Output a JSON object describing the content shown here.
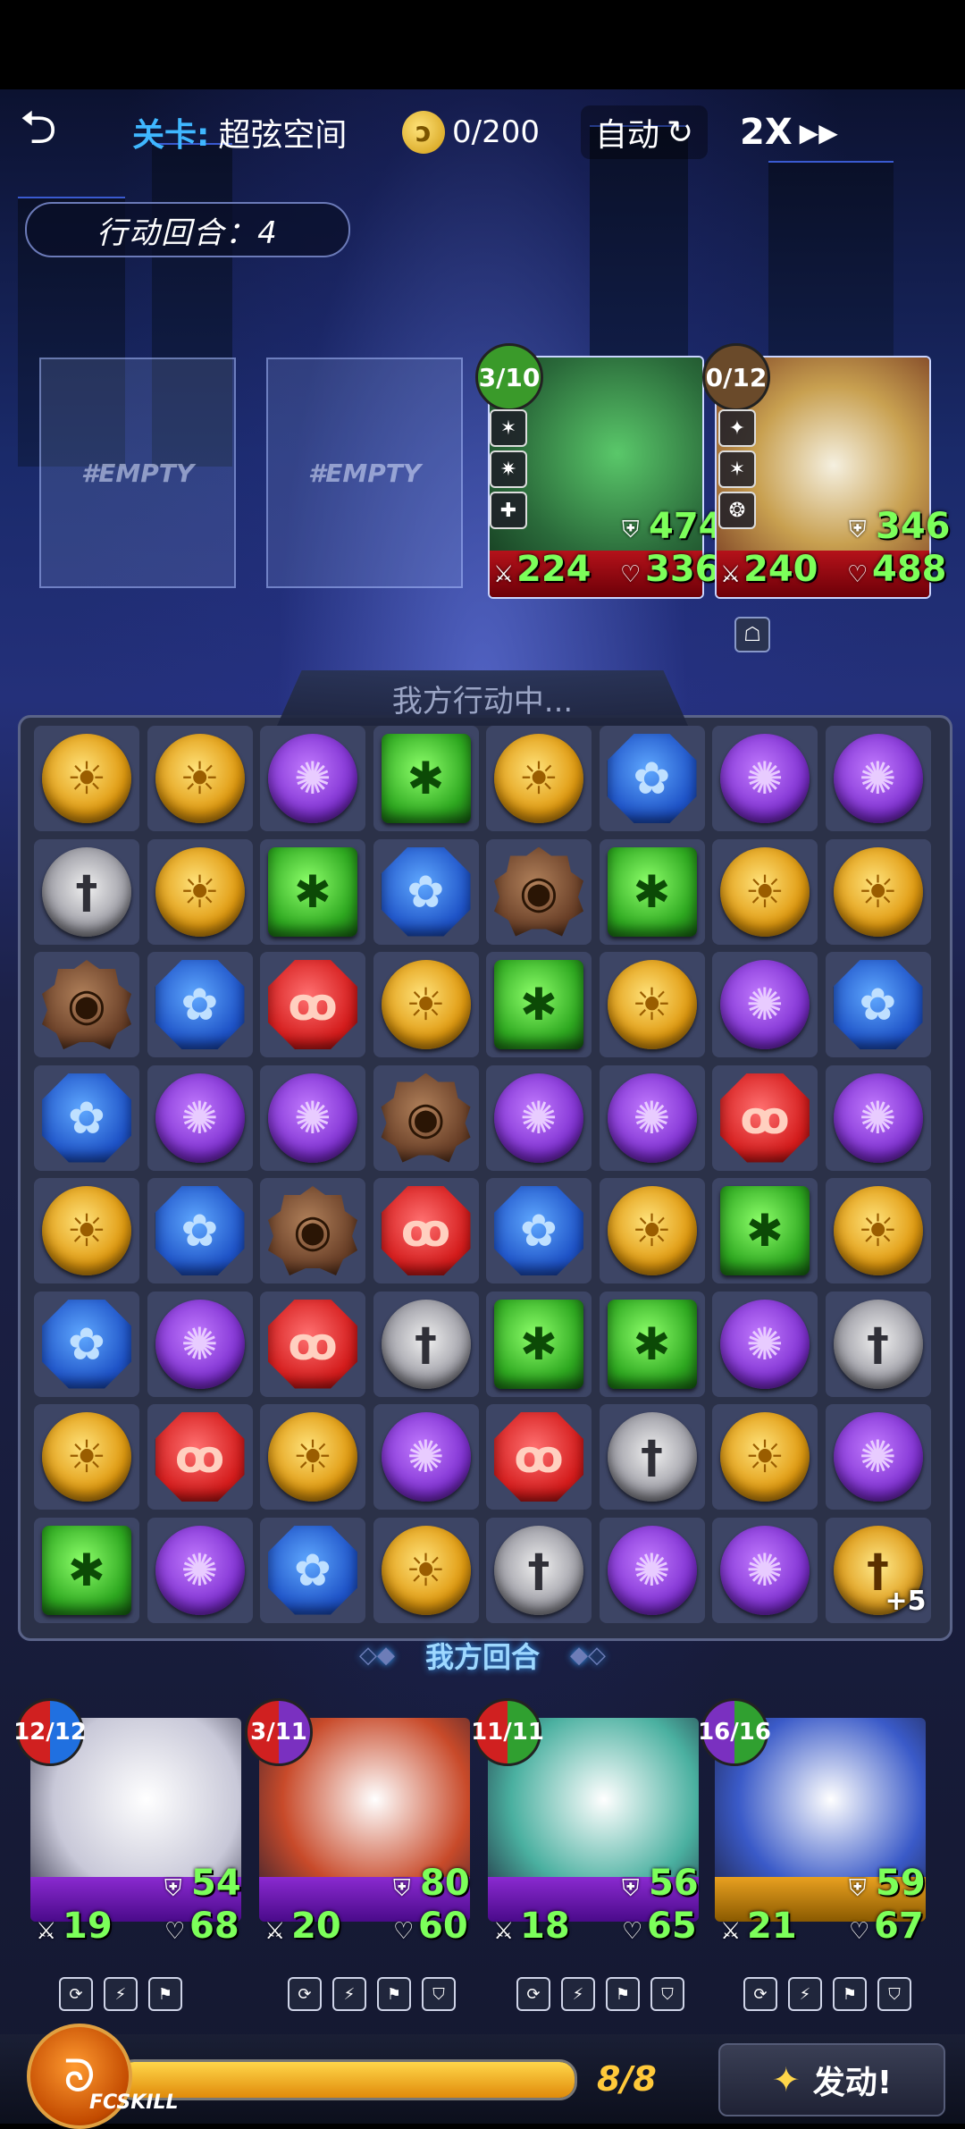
{
  "topbar": {
    "back_icon": "back-arrow-icon",
    "stage_label": "关卡:",
    "stage_name": "超弦空间",
    "coins": "0/200",
    "auto_label": "自动",
    "speed_label": "2X",
    "menu_icon": "grid-menu-icon"
  },
  "turn_counter": "行动回合：4",
  "empty_slots": [
    "#EMPTY",
    "#EMPTY"
  ],
  "enemies": [
    {
      "count": "3/10",
      "count_color": "#3a9a2a",
      "shield": "474",
      "attack": "224",
      "hp": "336",
      "art_color": "#2a6a3a"
    },
    {
      "count": "0/12",
      "count_color": "#6a4a2a",
      "shield": "346",
      "attack": "240",
      "hp": "488",
      "art_color": "#8a6a3a"
    }
  ],
  "board_status": "我方行动中...",
  "board": [
    [
      "sun",
      "sun",
      "purple",
      "green",
      "sun",
      "water",
      "purple",
      "purple"
    ],
    [
      "sword",
      "sun",
      "green",
      "water",
      "brown",
      "green",
      "sun",
      "sun"
    ],
    [
      "brown",
      "water",
      "red",
      "sun",
      "green",
      "sun",
      "purple",
      "water"
    ],
    [
      "water",
      "purple",
      "purple",
      "brown",
      "purple",
      "purple",
      "red",
      "purple"
    ],
    [
      "sun",
      "water",
      "brown",
      "red",
      "water",
      "sun",
      "green",
      "sun"
    ],
    [
      "water",
      "purple",
      "red",
      "sword",
      "green",
      "green",
      "purple",
      "sword"
    ],
    [
      "sun",
      "red",
      "sun",
      "purple",
      "red",
      "sword",
      "sun",
      "purple"
    ],
    [
      "green",
      "purple",
      "water",
      "sun",
      "sword",
      "purple",
      "purple",
      "gsword"
    ]
  ],
  "gold_sword_bonus": "+5",
  "turn_banner": "我方回合",
  "heroes": [
    {
      "count": "12/12",
      "shield": "54",
      "attack": "19",
      "hp": "68",
      "art_color": "#c8c8d8"
    },
    {
      "count": "3/11",
      "shield": "80",
      "attack": "20",
      "hp": "60",
      "art_color": "#c84a2a"
    },
    {
      "count": "11/11",
      "shield": "56",
      "attack": "18",
      "hp": "65",
      "art_color": "#4ab0a0"
    },
    {
      "count": "16/16",
      "shield": "59",
      "attack": "21",
      "hp": "67",
      "art_color": "#3a5ac8"
    }
  ],
  "skill_gauge": {
    "label": "FCSKILL",
    "value": "8/8",
    "fraction": 1.0
  },
  "launch_button": "发动!"
}
